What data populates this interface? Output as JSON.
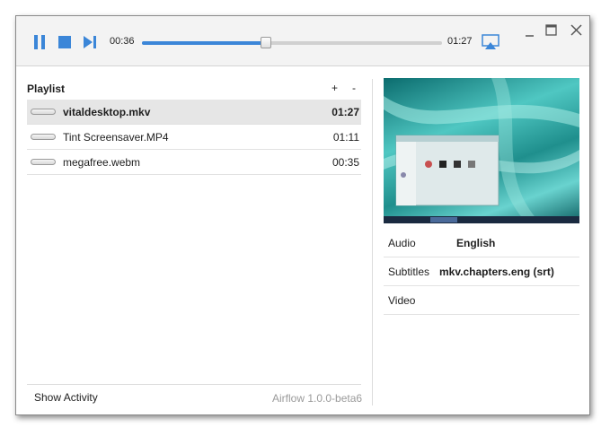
{
  "player": {
    "current_time": "00:36",
    "total_time": "01:27",
    "progress": 0.414
  },
  "playlist": {
    "title": "Playlist",
    "add_label": "+",
    "remove_label": "-",
    "items": [
      {
        "name": "vitaldesktop.mkv",
        "duration": "01:27"
      },
      {
        "name": "Tint Screensaver.MP4",
        "duration": "01:11"
      },
      {
        "name": "megafree.webm",
        "duration": "00:35"
      }
    ]
  },
  "footer": {
    "show_activity": "Show Activity",
    "version": "Airflow 1.0.0-beta6"
  },
  "info": {
    "audio_label": "Audio",
    "audio_value": "English",
    "subtitles_label": "Subtitles",
    "subtitles_value": "mkv.chapters.eng (srt)",
    "video_label": "Video"
  },
  "colors": {
    "accent": "#3b86d8",
    "selected_row": "#e6e6e6"
  }
}
